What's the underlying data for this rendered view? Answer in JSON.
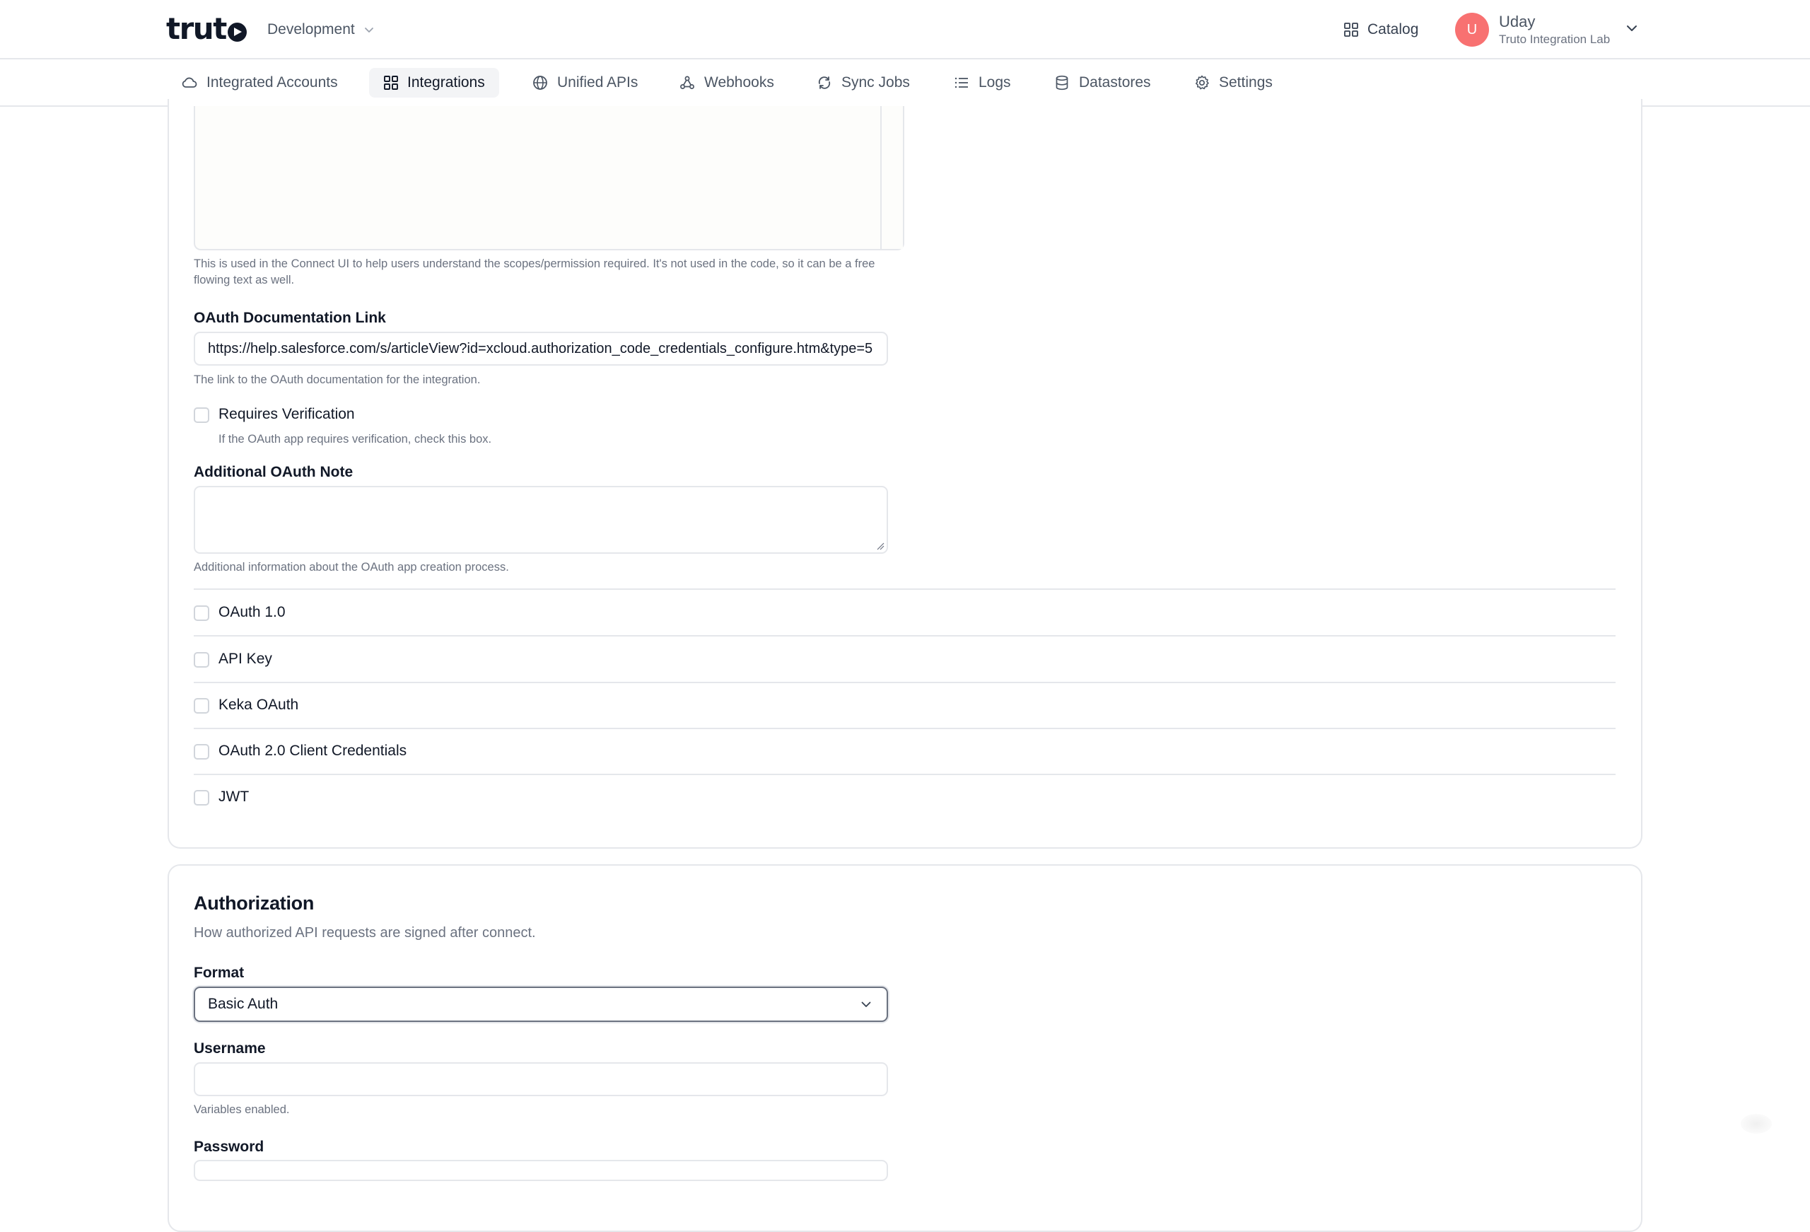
{
  "header": {
    "logo_text": "trut",
    "environment": "Development",
    "catalog_label": "Catalog",
    "user": {
      "initial": "U",
      "name": "Uday",
      "org": "Truto Integration Lab"
    }
  },
  "nav": {
    "tabs": [
      {
        "label": "Integrated Accounts",
        "icon": "cloud-icon"
      },
      {
        "label": "Integrations",
        "icon": "grid-icon",
        "active": true
      },
      {
        "label": "Unified APIs",
        "icon": "globe-icon"
      },
      {
        "label": "Webhooks",
        "icon": "webhook-icon"
      },
      {
        "label": "Sync Jobs",
        "icon": "sync-icon"
      },
      {
        "label": "Logs",
        "icon": "list-icon"
      },
      {
        "label": "Datastores",
        "icon": "database-icon"
      },
      {
        "label": "Settings",
        "icon": "gear-icon"
      }
    ]
  },
  "oauth": {
    "scopes_help": "This is used in the Connect UI to help users understand the scopes/permission required. It's not used in the code, so it can be a free flowing text as well.",
    "doc_link_label": "OAuth Documentation Link",
    "doc_link_value": "https://help.salesforce.com/s/articleView?id=xcloud.authorization_code_credentials_configure.htm&type=5",
    "doc_link_help": "The link to the OAuth documentation for the integration.",
    "requires_verification_label": "Requires Verification",
    "requires_verification_help": "If the OAuth app requires verification, check this box.",
    "additional_note_label": "Additional OAuth Note",
    "additional_note_value": "",
    "additional_note_help": "Additional information about the OAuth app creation process."
  },
  "auth_methods": [
    {
      "label": "OAuth 1.0",
      "checked": false
    },
    {
      "label": "API Key",
      "checked": false
    },
    {
      "label": "Keka OAuth",
      "checked": false
    },
    {
      "label": "OAuth 2.0 Client Credentials",
      "checked": false
    },
    {
      "label": "JWT",
      "checked": false
    }
  ],
  "authorization": {
    "title": "Authorization",
    "subtitle": "How authorized API requests are signed after connect.",
    "format_label": "Format",
    "format_value": "Basic Auth",
    "username_label": "Username",
    "username_value": "",
    "username_help": "Variables enabled.",
    "password_label": "Password"
  },
  "colors": {
    "avatar": "#f87171",
    "border": "#e5e7eb",
    "muted_text": "#6b7280"
  }
}
